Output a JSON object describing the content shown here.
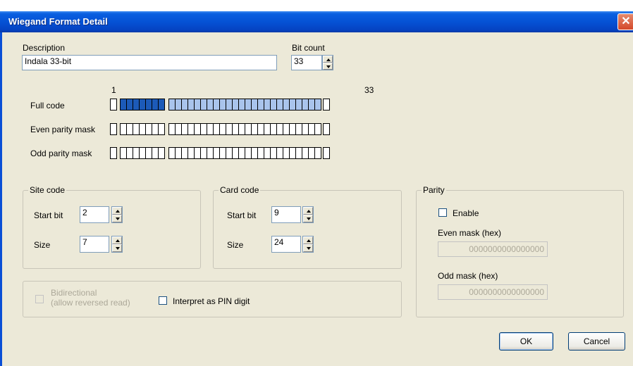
{
  "window": {
    "title": "Wiegand Format Detail"
  },
  "description": {
    "label": "Description",
    "value": "Indala 33-bit"
  },
  "bit_count": {
    "label": "Bit count",
    "value": "33"
  },
  "bit_display": {
    "start_label": "1",
    "end_label": "33",
    "full_code_label": "Full code",
    "even_parity_label": "Even parity mask",
    "odd_parity_label": "Odd parity mask",
    "total_bits": 33,
    "site_code_bits": [
      2,
      8
    ],
    "card_code_bits": [
      9,
      32
    ],
    "colors": {
      "site": "#1c5ab8",
      "card": "#a9c4ec",
      "empty": "#ffffff"
    }
  },
  "site_code": {
    "title": "Site code",
    "start_label": "Start bit",
    "start_value": "2",
    "size_label": "Size",
    "size_value": "7"
  },
  "card_code": {
    "title": "Card code",
    "start_label": "Start bit",
    "start_value": "9",
    "size_label": "Size",
    "size_value": "24"
  },
  "parity": {
    "title": "Parity",
    "enable_label": "Enable",
    "even_mask_label": "Even mask (hex)",
    "even_mask_value": "0000000000000000",
    "odd_mask_label": "Odd mask (hex)",
    "odd_mask_value": "0000000000000000"
  },
  "options": {
    "bidirectional_line1": "Bidirectional",
    "bidirectional_line2": "(allow reversed read)",
    "pin_digit_label": "Interpret as PIN digit"
  },
  "buttons": {
    "ok": "OK",
    "cancel": "Cancel"
  }
}
